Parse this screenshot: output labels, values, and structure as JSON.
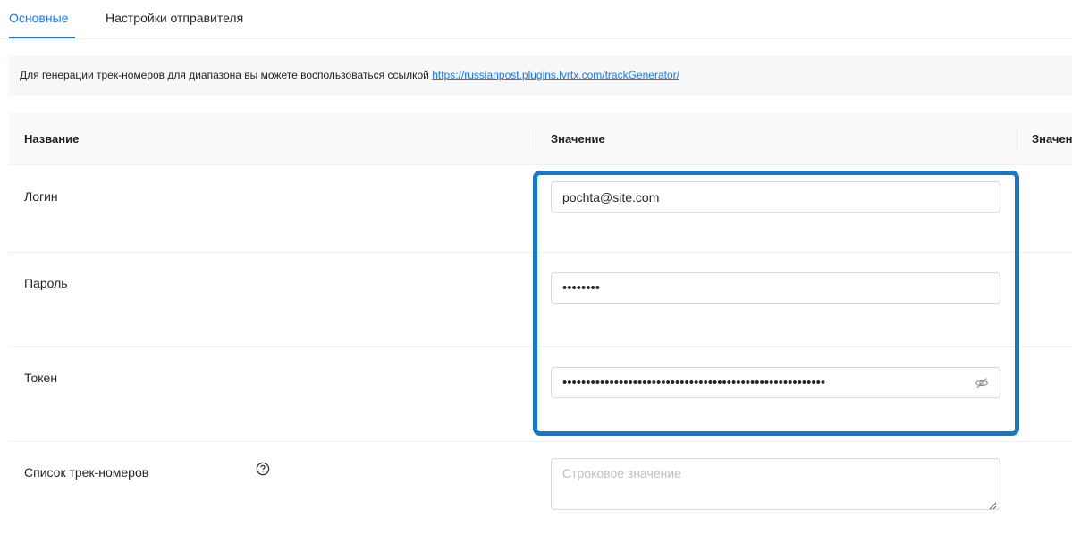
{
  "tabs": [
    {
      "label": "Основные",
      "active": true
    },
    {
      "label": "Настройки отправителя",
      "active": false
    }
  ],
  "info": {
    "text": "Для генерации трек-номеров для диапазона вы можете воспользоваться ссылкой ",
    "link": "https://russianpost.plugins.lvrtx.com/trackGenerator/"
  },
  "table": {
    "columns": [
      "Название",
      "Значение",
      "Значен"
    ],
    "rows": [
      {
        "label": "Логин",
        "value": "pochta@site.com"
      },
      {
        "label": "Пароль",
        "value": "••••••••"
      },
      {
        "label": "Токен",
        "value": "••••••••••••••••••••••••••••••••••••••••••••••••••••••••"
      },
      {
        "label": "Список трек-номеров",
        "placeholder": "Строковое значение"
      }
    ]
  },
  "icons": {
    "token_visibility": "eye-off-icon",
    "help": "question-circle-icon",
    "resize": "resize-handle-icon"
  },
  "colors": {
    "accent": "#1677ff",
    "highlight": "#1479c9"
  }
}
